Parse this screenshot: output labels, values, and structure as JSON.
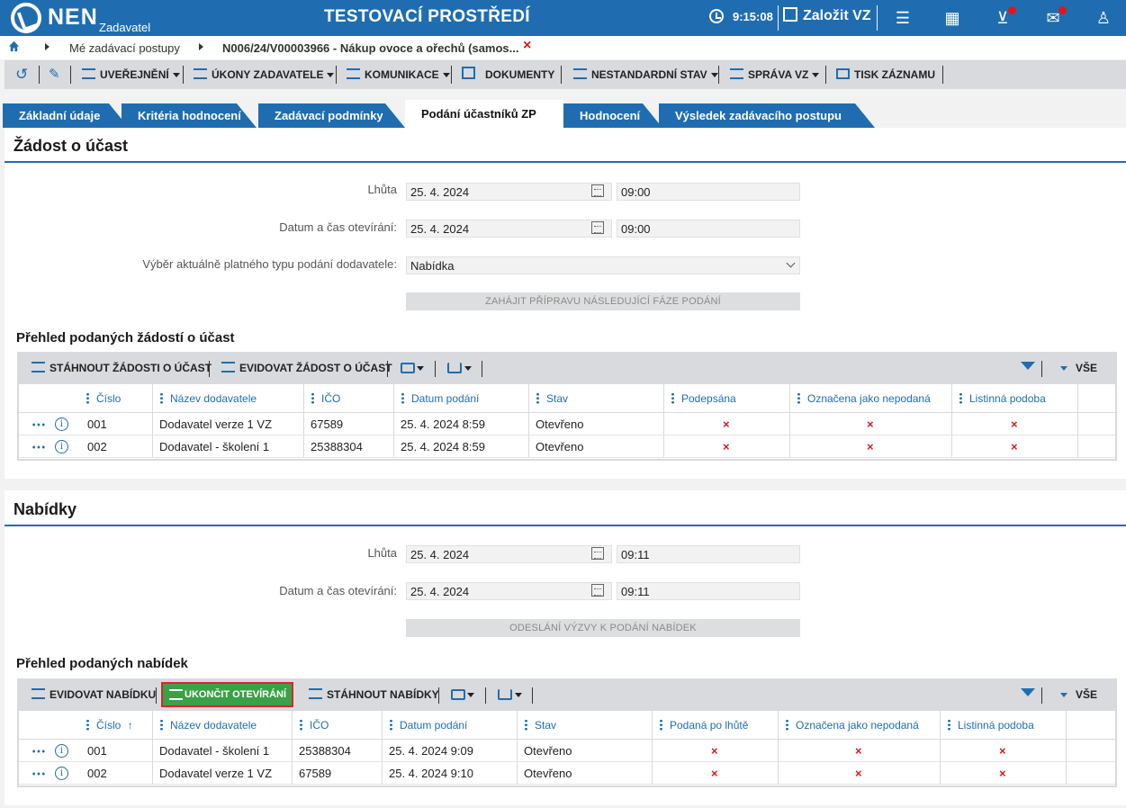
{
  "header": {
    "logo_text": "NEN",
    "logo_sub": "Zadavatel",
    "env_title": "TESTOVACÍ PROSTŘEDÍ",
    "time": "9:15:08",
    "create_label": "Založit VZ"
  },
  "breadcrumb": {
    "item1": "Mé zadávací postupy",
    "item2": "N006/24/V00003966 - Nákup ovoce a ořechů (samos...",
    "close": "×"
  },
  "toolbar": {
    "uverejneni": "UVEŘEJNĚNÍ",
    "ukony": "ÚKONY ZADAVATELE",
    "komunikace": "KOMUNIKACE",
    "dokumenty": "DOKUMENTY",
    "nestandardni": "NESTANDARDNÍ STAV",
    "sprava": "SPRÁVA VZ",
    "tisk": "TISK ZÁZNAMU"
  },
  "tabs": [
    {
      "label": "Základní údaje"
    },
    {
      "label": "Kritéria hodnocení"
    },
    {
      "label": "Zadávací podmínky"
    },
    {
      "label": "Podání účastníků ZP"
    },
    {
      "label": "Hodnocení"
    },
    {
      "label": "Výsledek zadávacího postupu"
    }
  ],
  "zadost": {
    "title": "Žádost o účast",
    "lhuta_label": "Lhůta",
    "lhuta_date": "25. 4. 2024",
    "lhuta_time": "09:00",
    "otevirani_label": "Datum a čas otevírání:",
    "otevirani_date": "25. 4. 2024",
    "otevirani_time": "09:00",
    "typ_label": "Výběr aktuálně platného typu podání dodavatele:",
    "typ_value": "Nabídka",
    "action_label": "ZAHÁJIT PŘÍPRAVU NÁSLEDUJÍCÍ FÁZE PODÁNÍ",
    "prehled_title": "Přehled podaných žádostí o účast",
    "btn_stahnout": "STÁHNOUT ŽÁDOSTI O ÚČAST",
    "btn_evidovat": "EVIDOVAT ŽÁDOST O ÚČAST",
    "vse": "VŠE",
    "columns": [
      "Číslo",
      "Název dodavatele",
      "IČO",
      "Datum podání",
      "Stav",
      "Podepsána",
      "Označena jako nepodaná",
      "Listinná podoba"
    ],
    "rows": [
      {
        "cislo": "001",
        "nazev": "Dodavatel verze 1 VZ",
        "ico": "67589",
        "datum": "25. 4. 2024 8:59",
        "stav": "Otevřeno",
        "x": "×"
      },
      {
        "cislo": "002",
        "nazev": "Dodavatel - školení 1",
        "ico": "25388304",
        "datum": "25. 4. 2024 8:59",
        "stav": "Otevřeno",
        "x": "×"
      }
    ]
  },
  "nabidky": {
    "title": "Nabídky",
    "lhuta_label": "Lhůta",
    "lhuta_date": "25. 4. 2024",
    "lhuta_time": "09:11",
    "otevirani_label": "Datum a čas otevírání:",
    "otevirani_date": "25. 4. 2024",
    "otevirani_time": "09:11",
    "action_label": "ODESLÁNÍ VÝZVY K PODÁNÍ NABÍDEK",
    "prehled_title": "Přehled podaných nabídek",
    "btn_evidovat": "EVIDOVAT NABÍDKU",
    "btn_ukoncit": "UKONČIT OTEVÍRÁNÍ",
    "btn_stahnout": "STÁHNOUT NABÍDKY",
    "vse": "VŠE",
    "columns": [
      "Číslo",
      "Název dodavatele",
      "IČO",
      "Datum podání",
      "Stav",
      "Podaná po lhůtě",
      "Označena jako nepodaná",
      "Listinná podoba"
    ],
    "sort_arrow": "↑",
    "rows": [
      {
        "cislo": "001",
        "nazev": "Dodavatel - školení 1",
        "ico": "25388304",
        "datum": "25. 4. 2024 9:09",
        "stav": "Otevřeno",
        "x": "×"
      },
      {
        "cislo": "002",
        "nazev": "Dodavatel verze 1 VZ",
        "ico": "67589",
        "datum": "25. 4. 2024 9:10",
        "stav": "Otevřeno",
        "x": "×"
      }
    ]
  },
  "colors": {
    "primary": "#1f6db0",
    "accent_red": "#e0161b",
    "success_green": "#3ba146"
  }
}
